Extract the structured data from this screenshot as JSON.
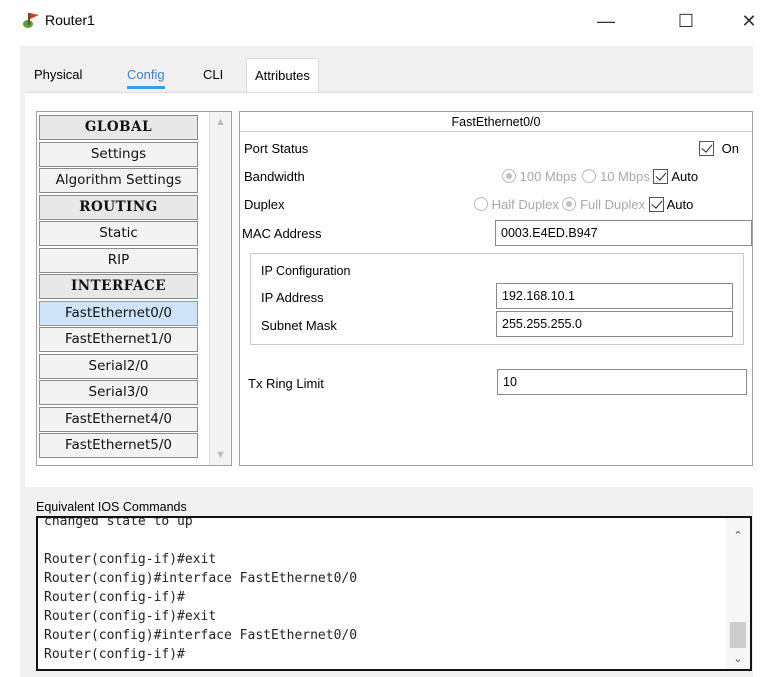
{
  "window": {
    "title": "Router1",
    "icon": "router-icon",
    "minimize": "—",
    "maximize": "☐",
    "close": "✕"
  },
  "tabs": [
    {
      "label": "Physical"
    },
    {
      "label": "Config",
      "selected": true
    },
    {
      "label": "CLI"
    },
    {
      "label": "Attributes"
    }
  ],
  "nav": {
    "items": [
      {
        "label": "GLOBAL",
        "type": "header"
      },
      {
        "label": "Settings"
      },
      {
        "label": "Algorithm Settings"
      },
      {
        "label": "ROUTING",
        "type": "header"
      },
      {
        "label": "Static"
      },
      {
        "label": "RIP"
      },
      {
        "label": "INTERFACE",
        "type": "header"
      },
      {
        "label": "FastEthernet0/0",
        "selected": true
      },
      {
        "label": "FastEthernet1/0"
      },
      {
        "label": "Serial2/0"
      },
      {
        "label": "Serial3/0"
      },
      {
        "label": "FastEthernet4/0"
      },
      {
        "label": "FastEthernet5/0"
      }
    ]
  },
  "details": {
    "title": "FastEthernet0/0",
    "port_status": {
      "label": "Port Status",
      "checkbox_label": "On",
      "checked": true
    },
    "bandwidth": {
      "label": "Bandwidth",
      "opt1": "100 Mbps",
      "opt2": "10 Mbps",
      "auto_label": "Auto",
      "auto_checked": true
    },
    "duplex": {
      "label": "Duplex",
      "opt1": "Half Duplex",
      "opt2": "Full Duplex",
      "auto_label": "Auto",
      "auto_checked": true
    },
    "mac": {
      "label": "MAC Address",
      "value": "0003.E4ED.B947"
    },
    "ip_config": {
      "legend": "IP Configuration",
      "ip_label": "IP Address",
      "ip_value": "192.168.10.1",
      "mask_label": "Subnet Mask",
      "mask_value": "255.255.255.0"
    },
    "tx_ring": {
      "label": "Tx Ring Limit",
      "value": "10"
    }
  },
  "ios": {
    "label": "Equivalent IOS Commands",
    "lines": [
      "changed state to up",
      "",
      "Router(config-if)#exit",
      "Router(config)#interface FastEthernet0/0",
      "Router(config-if)#",
      "Router(config-if)#exit",
      "Router(config)#interface FastEthernet0/0",
      "Router(config-if)#"
    ],
    "text": "changed state to up\n\nRouter(config-if)#exit\nRouter(config)#interface FastEthernet0/0\nRouter(config-if)#\nRouter(config-if)#exit\nRouter(config)#interface FastEthernet0/0\nRouter(config-if)#"
  },
  "colors": {
    "accent": "#3aa0e0",
    "selected_item": "#cfe3f8",
    "frame_bg": "#f0f0f0"
  }
}
